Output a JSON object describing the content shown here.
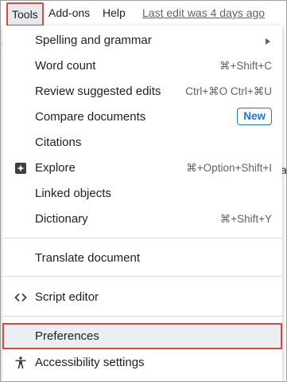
{
  "menubar": {
    "tools": "Tools",
    "addons": "Add-ons",
    "help": "Help",
    "last_edit": "Last edit was 4 days ago"
  },
  "background": {
    "frag1": "al",
    "frag2": "a"
  },
  "menu": {
    "spelling": {
      "label": "Spelling and grammar",
      "icon": "submenu-arrow-icon"
    },
    "word_count": {
      "label": "Word count",
      "shortcut": "⌘+Shift+C"
    },
    "review": {
      "label": "Review suggested edits",
      "shortcut": "Ctrl+⌘O Ctrl+⌘U"
    },
    "compare": {
      "label": "Compare documents",
      "badge": "New"
    },
    "citations": {
      "label": "Citations"
    },
    "explore": {
      "label": "Explore",
      "shortcut": "⌘+Option+Shift+I",
      "icon": "explore-icon"
    },
    "linked": {
      "label": "Linked objects"
    },
    "dictionary": {
      "label": "Dictionary",
      "shortcut": "⌘+Shift+Y"
    },
    "translate": {
      "label": "Translate document"
    },
    "script": {
      "label": "Script editor",
      "icon": "code-icon"
    },
    "preferences": {
      "label": "Preferences"
    },
    "accessibility": {
      "label": "Accessibility settings",
      "icon": "accessibility-icon"
    }
  },
  "colors": {
    "highlight": "#e0483f",
    "accent": "#1a73e8",
    "text": "#202124",
    "shortcut": "#5f6368"
  }
}
